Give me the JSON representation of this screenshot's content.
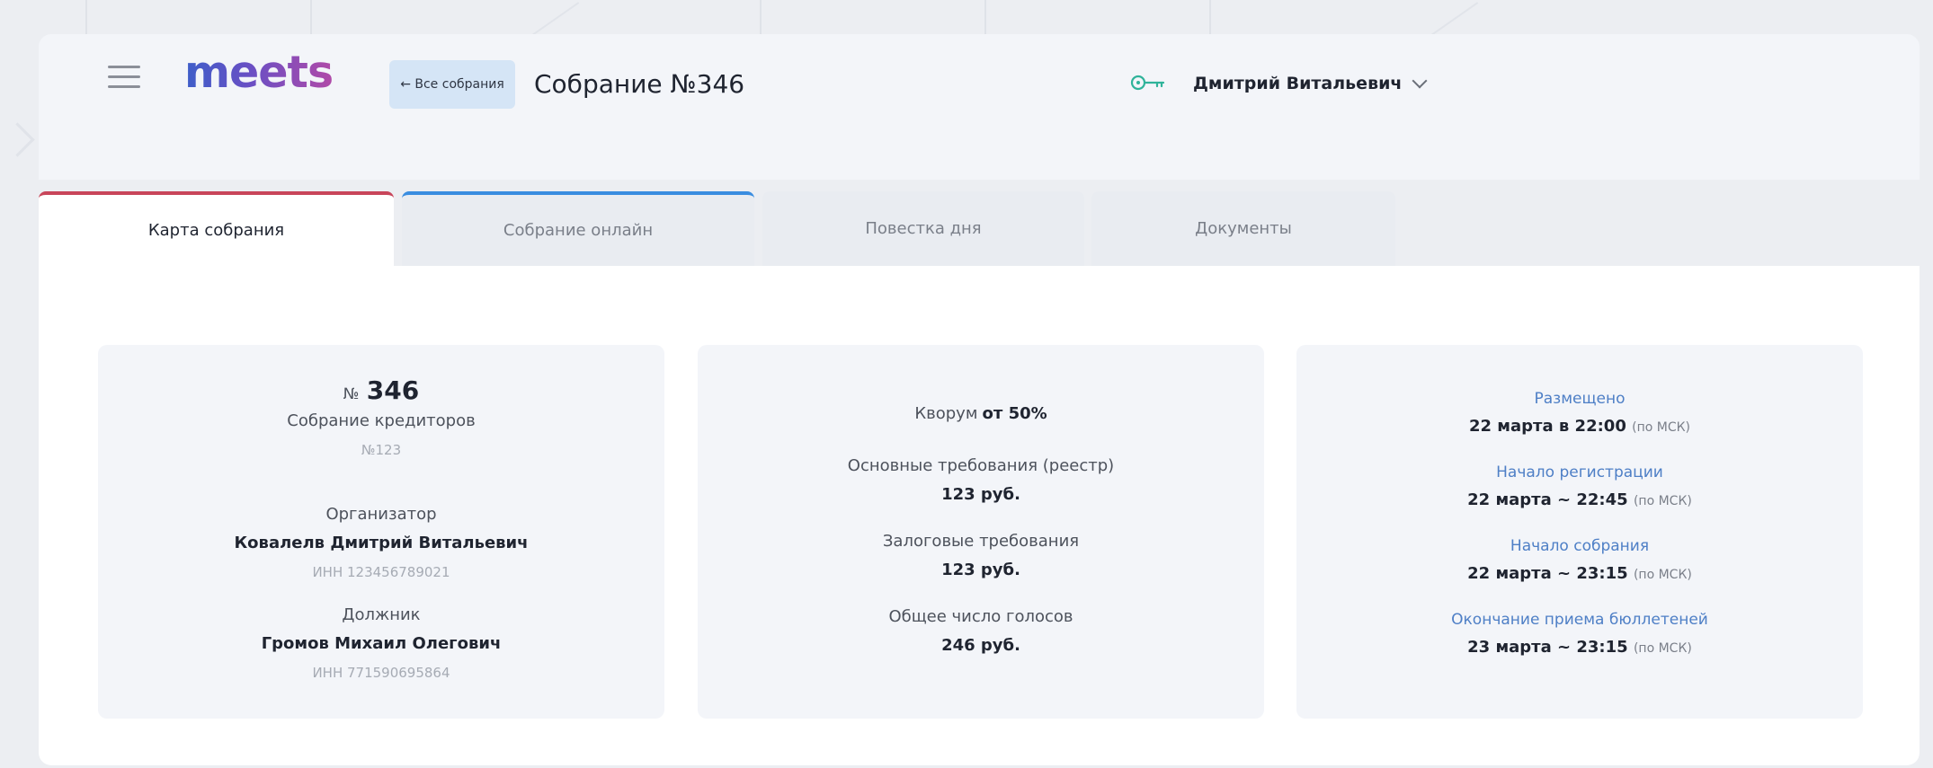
{
  "header": {
    "logo_text": "meets",
    "back_button_label": "← Все собрания",
    "meeting_title": "Собрание №346",
    "user_name": "Дмитрий Витальевич"
  },
  "tabs": [
    {
      "label": "Карта собрания",
      "active": true
    },
    {
      "label": "Собрание онлайн",
      "active": false
    },
    {
      "label": "Повестка дня",
      "active": false
    },
    {
      "label": "Документы",
      "active": false
    }
  ],
  "card_meeting": {
    "number_prefix": "№",
    "number": "346",
    "type": "Собрание кредиторов",
    "case_number": "№123",
    "organizer_label": "Организатор",
    "organizer_name": "Ковалелв Дмитрий Витальевич",
    "organizer_inn": "ИНН 123456789021",
    "debtor_label": "Должник",
    "debtor_name": "Громов Михаил Олегович",
    "debtor_inn": "ИНН 771590695864"
  },
  "card_quorum": {
    "quorum_label": "Кворум",
    "quorum_value": "от 50%",
    "main_claims_label": "Основные требования (реестр)",
    "main_claims_value": "123 руб.",
    "secured_claims_label": "Залоговые требования",
    "secured_claims_value": "123 руб.",
    "total_votes_label": "Общее число голосов",
    "total_votes_value": "246 руб."
  },
  "card_schedule": {
    "posted_label": "Размещено",
    "posted_value": "22 марта в 22:00",
    "registration_label": "Начало регистрации",
    "registration_value": "22 марта ~ 22:45",
    "start_label": "Начало собрания",
    "start_value": "22 марта ~ 23:15",
    "ballots_end_label": "Окончание приема бюллетеней",
    "ballots_end_value": "23 марта ~ 23:15",
    "timezone_note": "(по МСК)"
  },
  "colors": {
    "active_tab_accent": "#c8455a",
    "online_tab_accent": "#3a8de0",
    "link_blue": "#4e7fc6",
    "back_button_bg": "#d5e5f6"
  }
}
